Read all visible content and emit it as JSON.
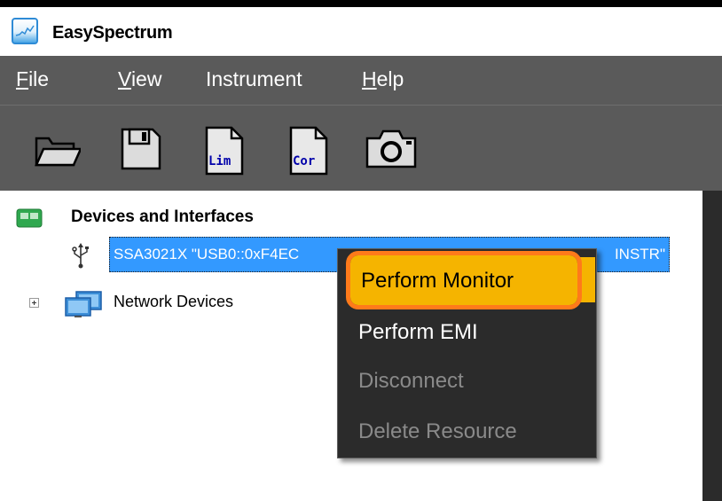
{
  "window": {
    "title": "EasySpectrum",
    "icon": "app-spectrum-icon"
  },
  "menubar": {
    "items": [
      {
        "label": "File"
      },
      {
        "label": "View"
      },
      {
        "label": "Instrument"
      },
      {
        "label": "Help"
      }
    ]
  },
  "toolbar": {
    "buttons": [
      {
        "icon": "open-folder-icon"
      },
      {
        "icon": "save-disk-icon"
      },
      {
        "icon": "limit-file-icon",
        "label": "Lim"
      },
      {
        "icon": "correction-file-icon",
        "label": "Cor"
      },
      {
        "icon": "camera-icon"
      }
    ]
  },
  "tree": {
    "root_label": "Devices and Interfaces",
    "device": {
      "label_left": "SSA3021X \"USB0::0xF4EC",
      "label_right": "INSTR\"",
      "icon": "usb-icon"
    },
    "network": {
      "label": "Network Devices",
      "icon": "network-monitors-icon"
    }
  },
  "context_menu": {
    "items": [
      {
        "label": "Perform Monitor",
        "state": "highlighted"
      },
      {
        "label": "Perform EMI",
        "state": "enabled"
      },
      {
        "label": "Disconnect",
        "state": "disabled"
      },
      {
        "label": "Delete Resource",
        "state": "disabled"
      }
    ]
  },
  "colors": {
    "menubar_bg": "#5a5a5a",
    "selection": "#3399ff",
    "menu_bg": "#2b2b2b",
    "highlight": "#f5b400",
    "highlight_ring": "#ff7a1a"
  }
}
